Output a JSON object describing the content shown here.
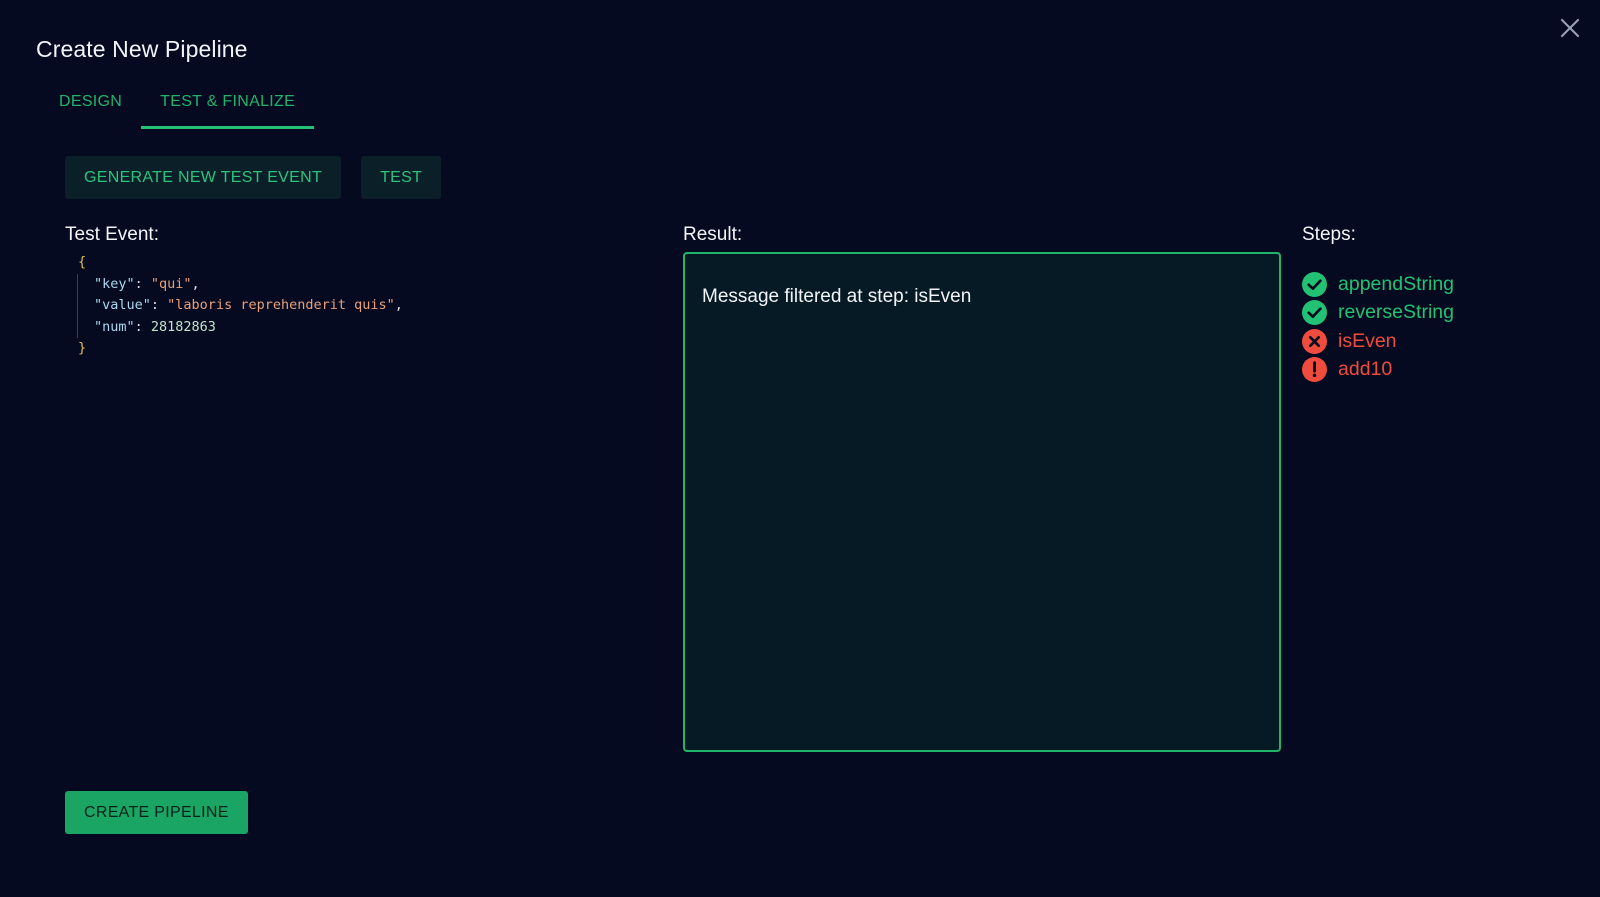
{
  "dialog": {
    "title": "Create New Pipeline",
    "close_icon": "close-icon"
  },
  "tabs": [
    {
      "label": "DESIGN",
      "active": false
    },
    {
      "label": "TEST & FINALIZE",
      "active": true
    }
  ],
  "actions": {
    "generate_label": "GENERATE NEW TEST EVENT",
    "test_label": "TEST",
    "create_label": "CREATE PIPELINE"
  },
  "test_event": {
    "label": "Test Event:",
    "open_brace": "{",
    "close_brace": "}",
    "fields": [
      {
        "key": "\"key\"",
        "value": "\"qui\"",
        "trail": ",",
        "type": "string"
      },
      {
        "key": "\"value\"",
        "value": "\"laboris reprehenderit quis\"",
        "trail": ",",
        "type": "string"
      },
      {
        "key": "\"num\"",
        "value": "28182863",
        "trail": "",
        "type": "number"
      }
    ]
  },
  "result": {
    "label": "Result:",
    "message": "Message filtered at step: isEven"
  },
  "steps": {
    "label": "Steps:",
    "items": [
      {
        "name": "appendString",
        "status": "success",
        "icon": "check-circle-icon"
      },
      {
        "name": "reverseString",
        "status": "success",
        "icon": "check-circle-icon"
      },
      {
        "name": "isEven",
        "status": "failed",
        "icon": "x-circle-icon"
      },
      {
        "name": "add10",
        "status": "warning",
        "icon": "exclamation-circle-icon"
      }
    ]
  },
  "colors": {
    "background": "#050a20",
    "accent": "#22c173",
    "error": "#f04c3e",
    "result_bg": "#061a25"
  }
}
